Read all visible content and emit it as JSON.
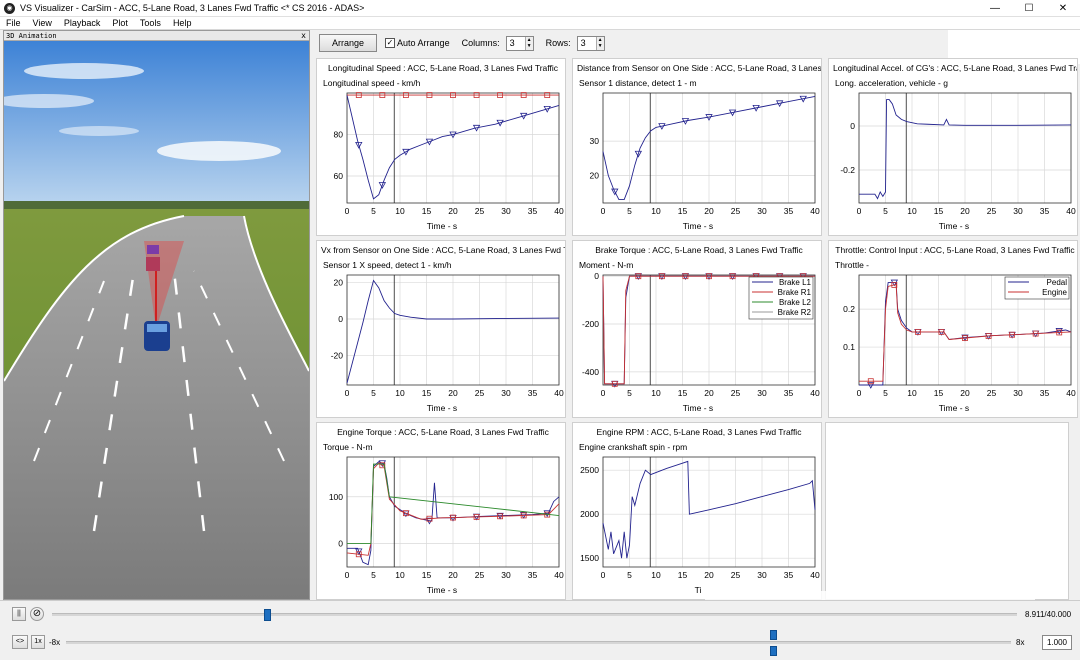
{
  "window": {
    "title": "VS Visualizer - CarSim - ACC, 5-Lane Road, 3 Lanes Fwd Traffic <* CS 2016 - ADAS>",
    "min": "—",
    "max": "☐",
    "close": "✕"
  },
  "menu": [
    "File",
    "View",
    "Playback",
    "Plot",
    "Tools",
    "Help"
  ],
  "animation": {
    "title": "3D Animation",
    "close": "x"
  },
  "toolbar": {
    "arrange": "Arrange",
    "auto_arrange": "Auto Arrange",
    "auto_checked": "✓",
    "columns_label": "Columns:",
    "columns": "3",
    "rows_label": "Rows:",
    "rows": "3"
  },
  "playback": {
    "pause": "||",
    "time": "8.911/40.000",
    "rewind": "<>",
    "speed_1x": "1x",
    "speed_left": "-8x",
    "speed_right": "8x",
    "speed_value": "1.000",
    "time_fraction": 0.2228
  },
  "colors": {
    "blue": "#23238e",
    "red": "#c83232",
    "green": "#2e8b2e",
    "grid": "#d9d9d9"
  },
  "plots": [
    {
      "title": "Longitudinal Speed : ACC, 5-Lane Road, 3 Lanes Fwd Traffic",
      "ylabel": "Longitudinal speed - km/h",
      "xlabel": "Time - s",
      "xticks": [
        0,
        5,
        10,
        15,
        20,
        25,
        30,
        35,
        40
      ],
      "yticks": [
        60,
        80
      ],
      "xlim": [
        0,
        40
      ],
      "ylim": [
        47,
        100
      ],
      "series": [
        {
          "color": "blue",
          "marker": "tri",
          "points": [
            [
              0,
              99
            ],
            [
              1,
              88
            ],
            [
              2,
              77
            ],
            [
              3,
              68
            ],
            [
              4,
              58
            ],
            [
              5,
              49
            ],
            [
              6,
              51
            ],
            [
              7,
              58
            ],
            [
              8,
              64
            ],
            [
              9,
              68
            ],
            [
              10,
              70
            ],
            [
              12,
              73
            ],
            [
              14,
              75
            ],
            [
              16,
              77
            ],
            [
              18,
              79
            ],
            [
              20,
              80
            ],
            [
              24,
              83
            ],
            [
              28,
              85
            ],
            [
              32,
              88
            ],
            [
              36,
              91
            ],
            [
              40,
              94
            ]
          ]
        },
        {
          "color": "red",
          "marker": "sq",
          "points": [
            [
              0,
              99
            ],
            [
              40,
              99
            ]
          ]
        }
      ]
    },
    {
      "title": "Distance from Sensor on One Side : ACC, 5-Lane Road, 3 Lanes",
      "ylabel": "Sensor 1 distance, detect 1 - m",
      "xlabel": "Time - s",
      "xticks": [
        0,
        5,
        10,
        15,
        20,
        25,
        30,
        35,
        40
      ],
      "yticks": [
        20,
        30
      ],
      "xlim": [
        0,
        40
      ],
      "ylim": [
        12,
        44
      ],
      "series": [
        {
          "color": "blue",
          "marker": "tri",
          "points": [
            [
              0,
              27
            ],
            [
              1,
              20
            ],
            [
              2,
              16
            ],
            [
              3,
              13
            ],
            [
              4,
              13
            ],
            [
              5,
              17
            ],
            [
              6,
              23
            ],
            [
              7,
              28
            ],
            [
              8,
              31
            ],
            [
              9,
              33
            ],
            [
              10,
              34
            ],
            [
              13,
              35
            ],
            [
              16,
              36
            ],
            [
              20,
              37
            ],
            [
              25,
              38.5
            ],
            [
              30,
              40
            ],
            [
              35,
              41.5
            ],
            [
              40,
              43
            ]
          ]
        }
      ]
    },
    {
      "title": "Longitudinal Accel. of CG's : ACC, 5-Lane Road, 3 Lanes Fwd Tra",
      "ylabel": "Long. acceleration, vehicle - g",
      "xlabel": "Time - s",
      "xticks": [
        0,
        5,
        10,
        15,
        20,
        25,
        30,
        35,
        40
      ],
      "yticks": [
        -0.2,
        0
      ],
      "xlim": [
        0,
        40
      ],
      "ylim": [
        -0.35,
        0.15
      ],
      "series": [
        {
          "color": "blue",
          "marker": "none",
          "points": [
            [
              0,
              -0.31
            ],
            [
              3,
              -0.31
            ],
            [
              3.5,
              -0.33
            ],
            [
              4,
              -0.3
            ],
            [
              4.5,
              -0.32
            ],
            [
              5,
              -0.3
            ],
            [
              5.2,
              0.12
            ],
            [
              5.7,
              0.12
            ],
            [
              6,
              0.11
            ],
            [
              6.3,
              0.1
            ],
            [
              7,
              0.05
            ],
            [
              8,
              0.03
            ],
            [
              9,
              0.02
            ],
            [
              11,
              0.01
            ],
            [
              13,
              0.008
            ],
            [
              16,
              0.005
            ],
            [
              16.5,
              0.03
            ],
            [
              17,
              0.005
            ],
            [
              20,
              0.003
            ],
            [
              30,
              0.003
            ],
            [
              40,
              0.005
            ]
          ]
        }
      ]
    },
    {
      "title": "Vx from Sensor on One Side : ACC, 5-Lane Road, 3 Lanes Fwd T",
      "ylabel": "Sensor 1 X speed, detect 1 - km/h",
      "xlabel": "Time - s",
      "xticks": [
        0,
        5,
        10,
        15,
        20,
        25,
        30,
        35,
        40
      ],
      "yticks": [
        -20,
        0,
        20
      ],
      "xlim": [
        0,
        40
      ],
      "ylim": [
        -36,
        24
      ],
      "series": [
        {
          "color": "blue",
          "marker": "none",
          "points": [
            [
              0,
              -35
            ],
            [
              1,
              -24
            ],
            [
              2,
              -13
            ],
            [
              3,
              -2
            ],
            [
              4,
              10
            ],
            [
              5,
              21
            ],
            [
              6,
              17
            ],
            [
              7,
              10
            ],
            [
              8,
              6
            ],
            [
              9,
              3
            ],
            [
              10,
              2
            ],
            [
              12,
              1
            ],
            [
              15,
              0
            ],
            [
              20,
              0
            ],
            [
              30,
              0.3
            ],
            [
              40,
              0.5
            ]
          ]
        }
      ]
    },
    {
      "title": "Brake Torque : ACC, 5-Lane Road, 3 Lanes Fwd Traffic",
      "ylabel": "Moment - N-m",
      "xlabel": "Time - s",
      "xticks": [
        0,
        5,
        10,
        15,
        20,
        25,
        30,
        35,
        40
      ],
      "yticks": [
        -400,
        -200,
        0
      ],
      "xlim": [
        0,
        40
      ],
      "ylim": [
        -455,
        5
      ],
      "legend": [
        "Brake L1",
        "Brake R1",
        "Brake L2",
        "Brake R2"
      ],
      "series": [
        {
          "color": "blue",
          "marker": "tri",
          "points": [
            [
              0,
              0
            ],
            [
              0.3,
              -450
            ],
            [
              4,
              -450
            ],
            [
              4.3,
              -90
            ],
            [
              5,
              0
            ],
            [
              40,
              0
            ]
          ]
        },
        {
          "color": "red",
          "marker": "sq",
          "points": [
            [
              0,
              0
            ],
            [
              0.3,
              -450
            ],
            [
              4,
              -450
            ],
            [
              4.3,
              -60
            ],
            [
              5,
              0
            ],
            [
              40,
              0
            ]
          ]
        }
      ]
    },
    {
      "title": "Throttle: Control Input : ACC, 5-Lane Road, 3 Lanes Fwd Traffic",
      "ylabel": "Throttle -",
      "xlabel": "Time - s",
      "xticks": [
        0,
        5,
        10,
        15,
        20,
        25,
        30,
        35,
        40
      ],
      "yticks": [
        0.1,
        0.2
      ],
      "xlim": [
        0,
        40
      ],
      "ylim": [
        0,
        0.29
      ],
      "legend": [
        "Pedal",
        "Engine"
      ],
      "series": [
        {
          "color": "blue",
          "marker": "tri",
          "points": [
            [
              0,
              0
            ],
            [
              4.5,
              0
            ],
            [
              5,
              0.22
            ],
            [
              5.5,
              0.27
            ],
            [
              7,
              0.27
            ],
            [
              7.3,
              0.2
            ],
            [
              8,
              0.17
            ],
            [
              9,
              0.15
            ],
            [
              10,
              0.14
            ],
            [
              13,
              0.14
            ],
            [
              16,
              0.14
            ],
            [
              17,
              0.12
            ],
            [
              20,
              0.125
            ],
            [
              25,
              0.13
            ],
            [
              30,
              0.133
            ],
            [
              35,
              0.137
            ],
            [
              39,
              0.145
            ],
            [
              40,
              0.14
            ]
          ]
        },
        {
          "color": "red",
          "marker": "sq",
          "points": [
            [
              0,
              0.01
            ],
            [
              4.5,
              0.01
            ],
            [
              5,
              0.2
            ],
            [
              5.5,
              0.26
            ],
            [
              7,
              0.265
            ],
            [
              7.3,
              0.19
            ],
            [
              8,
              0.16
            ],
            [
              9,
              0.145
            ],
            [
              10,
              0.14
            ],
            [
              16,
              0.14
            ],
            [
              17,
              0.12
            ],
            [
              25,
              0.13
            ],
            [
              40,
              0.14
            ]
          ]
        }
      ]
    },
    {
      "title": "Engine Torque : ACC, 5-Lane Road, 3 Lanes Fwd Traffic",
      "ylabel": "Torque - N-m",
      "xlabel": "Time - s",
      "xticks": [
        0,
        5,
        10,
        15,
        20,
        25,
        30,
        35,
        40
      ],
      "yticks": [
        0,
        100
      ],
      "xlim": [
        0,
        40
      ],
      "ylim": [
        -50,
        185
      ],
      "series": [
        {
          "color": "blue",
          "marker": "tri",
          "points": [
            [
              0,
              -10
            ],
            [
              2,
              -10
            ],
            [
              3,
              -40
            ],
            [
              4,
              -45
            ],
            [
              4.5,
              -15
            ],
            [
              5,
              165
            ],
            [
              6,
              175
            ],
            [
              7,
              170
            ],
            [
              7.5,
              140
            ],
            [
              8,
              100
            ],
            [
              9,
              80
            ],
            [
              11,
              65
            ],
            [
              13,
              55
            ],
            [
              15,
              50
            ],
            [
              16,
              48
            ],
            [
              16.5,
              130
            ],
            [
              17,
              55
            ],
            [
              20,
              55
            ],
            [
              25,
              58
            ],
            [
              30,
              60
            ],
            [
              35,
              62
            ],
            [
              38,
              65
            ],
            [
              39,
              90
            ],
            [
              40,
              100
            ]
          ]
        },
        {
          "color": "red",
          "marker": "sq",
          "points": [
            [
              0,
              -20
            ],
            [
              4,
              -25
            ],
            [
              4.5,
              0
            ],
            [
              5,
              160
            ],
            [
              6,
              172
            ],
            [
              7,
              165
            ],
            [
              8,
              95
            ],
            [
              10,
              70
            ],
            [
              14,
              52
            ],
            [
              18,
              55
            ],
            [
              28,
              58
            ],
            [
              38,
              62
            ],
            [
              40,
              85
            ]
          ]
        },
        {
          "color": "green",
          "marker": "none",
          "points": [
            [
              0,
              0
            ],
            [
              4.5,
              0
            ],
            [
              5,
              170
            ],
            [
              7,
              170
            ],
            [
              8,
              100
            ],
            [
              40,
              60
            ]
          ]
        }
      ]
    },
    {
      "title": "Engine RPM : ACC, 5-Lane Road, 3 Lanes Fwd Traffic",
      "ylabel": "Engine crankshaft spin - rpm",
      "xlabel": "Ti",
      "xticks": [
        0,
        5,
        10,
        15,
        20,
        25,
        30,
        35,
        40
      ],
      "yticks": [
        1500,
        2000,
        2500
      ],
      "xlim": [
        0,
        40
      ],
      "ylim": [
        1400,
        2650
      ],
      "series": [
        {
          "color": "blue",
          "marker": "none",
          "points": [
            [
              0,
              1900
            ],
            [
              0.5,
              1750
            ],
            [
              1,
              1600
            ],
            [
              1.5,
              1800
            ],
            [
              2,
              1550
            ],
            [
              3,
              1700
            ],
            [
              3.5,
              1500
            ],
            [
              4,
              1800
            ],
            [
              4.5,
              1500
            ],
            [
              5,
              1650
            ],
            [
              5.5,
              2200
            ],
            [
              6,
              2100
            ],
            [
              7,
              2350
            ],
            [
              8,
              2500
            ],
            [
              9,
              2450
            ],
            [
              12,
              2520
            ],
            [
              14,
              2560
            ],
            [
              16,
              2600
            ],
            [
              16.3,
              2000
            ],
            [
              20,
              2050
            ],
            [
              25,
              2120
            ],
            [
              30,
              2200
            ],
            [
              35,
              2280
            ],
            [
              39,
              2350
            ],
            [
              39.5,
              2380
            ],
            [
              40,
              2050
            ]
          ]
        }
      ]
    }
  ]
}
